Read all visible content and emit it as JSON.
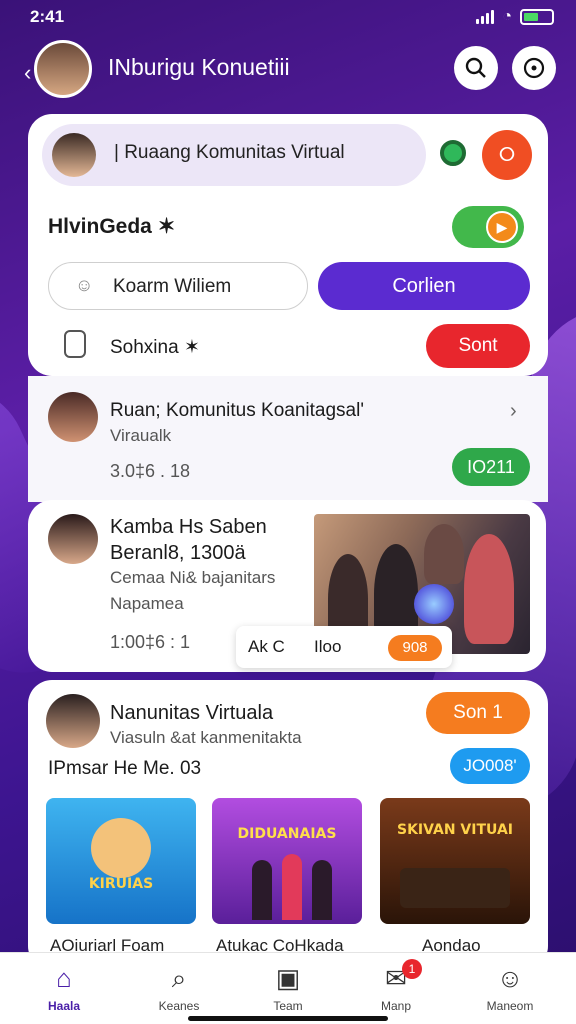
{
  "status_bar": {
    "time": "2:41"
  },
  "header": {
    "title": "INburigu Konuetiii"
  },
  "card1": {
    "search_text": "| Ruaang Komunitas Virtual",
    "row_title": "HlvinGeda ✶",
    "outline_pill_label": "Koarm Wiliem",
    "purple_pill_label": "Corlien",
    "sub_row_label": "Sohxina ✶",
    "red_pill_label": "Sont"
  },
  "list_item": {
    "title": "Ruan; Komunitus Koanitagsal'",
    "sub": "Viraualk",
    "meta": "3.0‡6 . 18",
    "badge": "IO211"
  },
  "card2": {
    "title": "Kamba Hs Saben",
    "num": "Beranl8, 1300ä",
    "sub1": "Cemaa Ni& bajanitars",
    "sub2": "Napamea",
    "time": "1:00‡6 : 1",
    "float_a": "Ak C",
    "float_b": "Iloo",
    "float_c": "908"
  },
  "card3": {
    "title": "Nanunitas Virtuala",
    "sub": "Viasuln &at kanmenitakta",
    "row": "IPmsar He  Me. 03",
    "orange_pill": "Son 1",
    "blue_pill": "JO008'",
    "tiles": [
      {
        "art_text": "KIRUIAS",
        "label": "AOiuriarl Foam"
      },
      {
        "art_text": "DIDUANAIAS",
        "label": "Atukac CoHkada"
      },
      {
        "art_text": "SKIVAN VITUAI",
        "label": "Aondao"
      }
    ]
  },
  "nav": {
    "items": [
      {
        "label": "Haala",
        "icon": "home-icon"
      },
      {
        "label": "Keanes",
        "icon": "search-icon"
      },
      {
        "label": "Team",
        "icon": "calendar-icon"
      },
      {
        "label": "Manp",
        "icon": "mail-icon",
        "badge": "1"
      },
      {
        "label": "Maneom",
        "icon": "profile-icon"
      }
    ]
  }
}
